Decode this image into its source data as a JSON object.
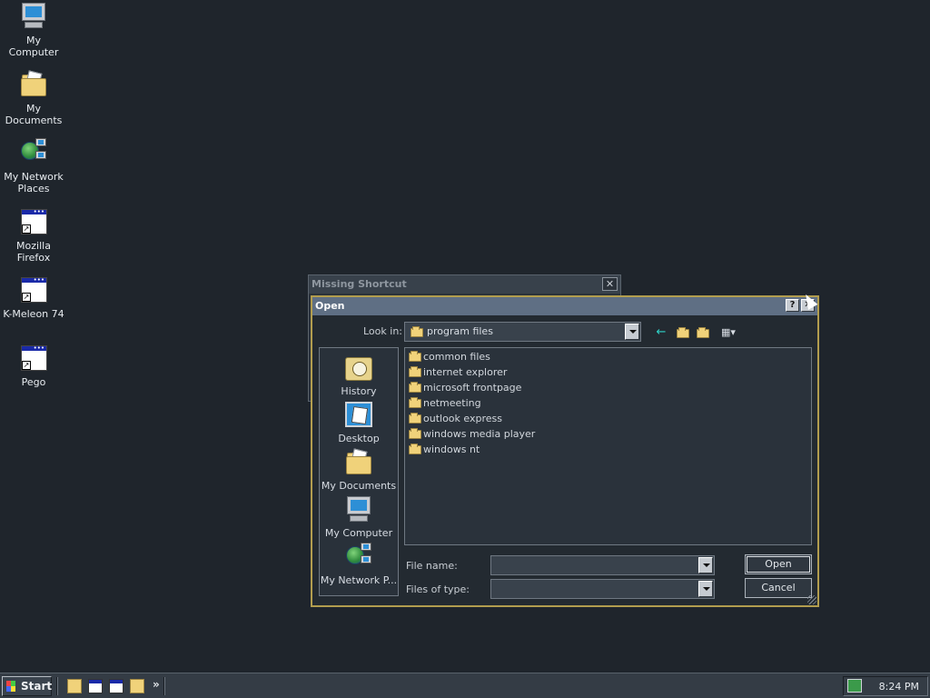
{
  "desktop": {
    "icons": [
      {
        "label": "My Computer",
        "icon": "my-computer-icon"
      },
      {
        "label": "My Documents",
        "icon": "my-documents-icon"
      },
      {
        "label": "My Network Places",
        "icon": "network-places-icon"
      },
      {
        "label": "Mozilla Firefox",
        "icon": "shortcut-app-icon"
      },
      {
        "label": "K-Meleon 74",
        "icon": "shortcut-app-icon"
      },
      {
        "label": "Pego",
        "icon": "shortcut-app-icon"
      }
    ]
  },
  "back_window": {
    "title": "Missing Shortcut",
    "close_glyph": "✕"
  },
  "dialog": {
    "title": "Open",
    "help_glyph": "?",
    "close_glyph": "✕",
    "look_in_label": "Look in:",
    "look_in_value": "program files",
    "toolbar": {
      "back_glyph": "←",
      "up_glyph": "⤒",
      "new_folder_glyph": "✶",
      "view_glyph": "▦▾"
    },
    "places": [
      {
        "label": "History",
        "icon": "history-icon"
      },
      {
        "label": "Desktop",
        "icon": "desktop-icon"
      },
      {
        "label": "My Documents",
        "icon": "my-documents-icon"
      },
      {
        "label": "My Computer",
        "icon": "my-computer-icon"
      },
      {
        "label": "My Network P...",
        "icon": "network-places-icon"
      }
    ],
    "files": [
      "common files",
      "internet explorer",
      "microsoft frontpage",
      "netmeeting",
      "outlook express",
      "windows media player",
      "windows nt"
    ],
    "file_name_label": "File name:",
    "file_name_value": "",
    "files_of_type_label": "Files of type:",
    "files_of_type_value": "",
    "open_button": "Open",
    "cancel_button": "Cancel"
  },
  "taskbar": {
    "start_label": "Start",
    "chevron": "»",
    "clock": "8:24 PM"
  },
  "colors": {
    "desktop_bg": "#1f252c",
    "dialog_title_bg": "#5f6f84",
    "dialog_border": "#b29d4e",
    "folder": "#f0d27a"
  }
}
